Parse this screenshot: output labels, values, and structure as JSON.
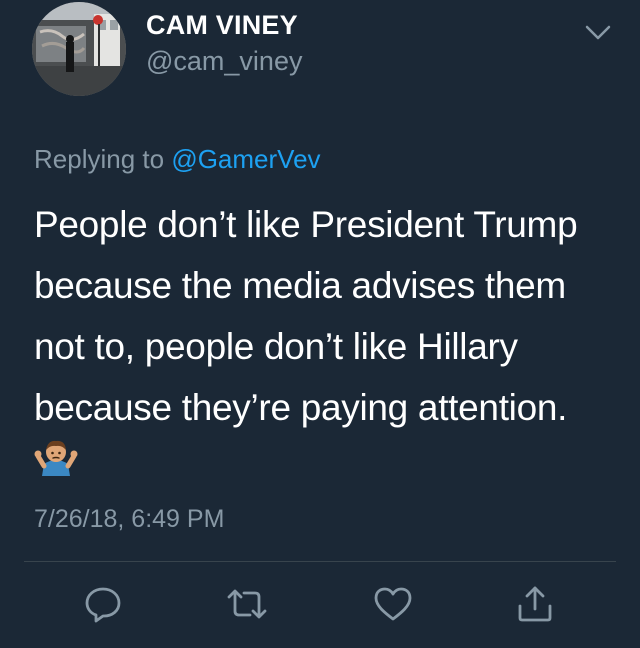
{
  "user": {
    "display_name": "CAM VINEY",
    "handle": "@cam_viney",
    "avatar_icon": "profile-photo"
  },
  "reply": {
    "prefix": "Replying to",
    "mention": "@GamerVev"
  },
  "tweet": {
    "lines": [
      "People don’t like President Trump",
      "because the media advises them",
      "not to, people don’t like Hillary",
      "because they’re paying attention."
    ],
    "emoji": "shrug-emoji",
    "timestamp": "7/26/18, 6:49 PM"
  },
  "actions": [
    {
      "name": "reply",
      "icon": "speech-bubble-icon"
    },
    {
      "name": "retweet",
      "icon": "retweet-icon"
    },
    {
      "name": "like",
      "icon": "heart-icon"
    },
    {
      "name": "share",
      "icon": "share-icon"
    }
  ],
  "colors": {
    "background": "#1b2836",
    "primary_text": "#ffffff",
    "secondary_text": "#8899a6",
    "link": "#1da1f2",
    "divider": "#38444d"
  }
}
